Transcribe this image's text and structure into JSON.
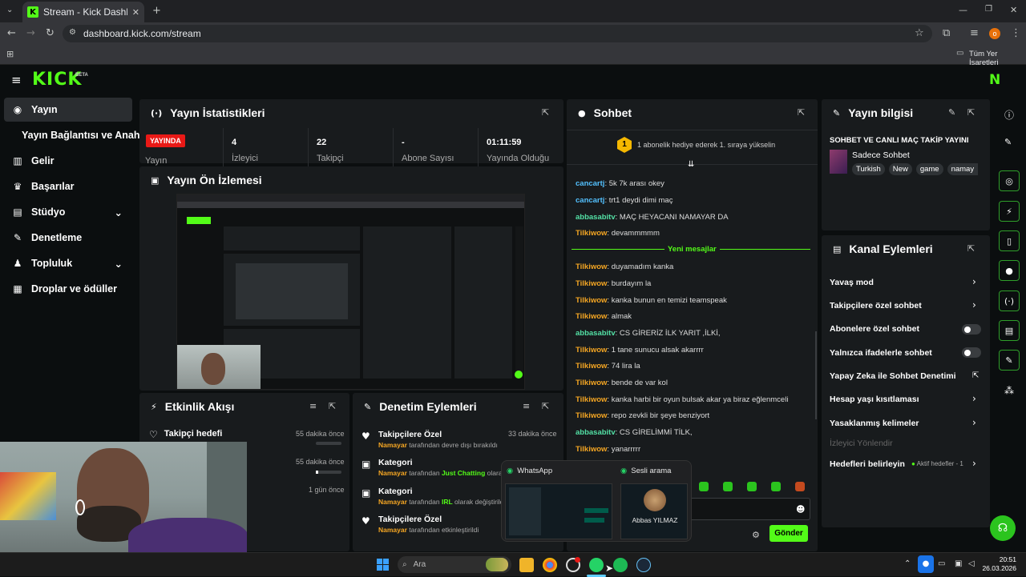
{
  "browser": {
    "tab_title": "Stream - Kick Dashboard",
    "url": "dashboard.kick.com/stream",
    "bookmarks_label": "Tüm Yer İşaretleri",
    "profile_initial": "o"
  },
  "header": {
    "logo": "KICK",
    "beta": "BETA",
    "avatar_initial": "N"
  },
  "sidebar": {
    "items": [
      {
        "label": "Yayın",
        "icon": "broadcast-icon"
      },
      {
        "label": "Yayın Bağlantısı ve Anahtarı",
        "icon": ""
      },
      {
        "label": "Gelir",
        "icon": "chart-icon"
      },
      {
        "label": "Başarılar",
        "icon": "trophy-icon"
      },
      {
        "label": "Stüdyo",
        "icon": "studio-icon"
      },
      {
        "label": "Denetleme",
        "icon": "wrench-icon"
      },
      {
        "label": "Topluluk",
        "icon": "people-icon"
      },
      {
        "label": "Droplar ve ödüller",
        "icon": "gift-icon"
      }
    ]
  },
  "stats": {
    "title": "Yayın İstatistikleri",
    "live_badge": "YAYINDA",
    "live_label": "Yayın",
    "cells": [
      {
        "value": "4",
        "label": "İzleyici"
      },
      {
        "value": "22",
        "label": "Takipçi"
      },
      {
        "value": "-",
        "label": "Abone Sayısı"
      },
      {
        "value": "01:11:59",
        "label": "Yayında Olduğu"
      }
    ]
  },
  "preview": {
    "title": "Yayın Ön İzlemesi"
  },
  "activity": {
    "title": "Etkinlik Akışı",
    "items": [
      {
        "title": "Takipçi hedefi",
        "time": "55 dakika önce"
      },
      {
        "title": "",
        "time": "55 dakika önce"
      },
      {
        "title": "",
        "time": "1 gün önce"
      }
    ]
  },
  "moderation": {
    "title": "Denetim Eylemleri",
    "items": [
      {
        "title": "Takipçilere Özel",
        "user": "Namayar",
        "desc": "tarafından devre dışı bırakıldı",
        "highlight": "",
        "desc2": "",
        "time": "33 dakika önce"
      },
      {
        "title": "Kategori",
        "user": "Namayar",
        "desc": "tarafından",
        "highlight": "Just Chatting",
        "desc2": "olara",
        "time": ""
      },
      {
        "title": "Kategori",
        "user": "Namayar",
        "desc": "tarafından",
        "highlight": "IRL",
        "desc2": "olarak değiştirild",
        "time": ""
      },
      {
        "title": "Takipçilere Özel",
        "user": "Namayar",
        "desc": "tarafından etkinleştirildi",
        "highlight": "",
        "desc2": "",
        "time": ""
      }
    ]
  },
  "chat": {
    "title": "Sohbet",
    "pinned_number": "1",
    "pinned_text": "1 abonelik hediye ederek 1. sıraya yükselin",
    "new_messages": "Yeni mesajlar",
    "messages_before": [
      {
        "user": "cancartj",
        "text": "5k 7k arası okey",
        "color": "#53c1ff"
      },
      {
        "user": "cancartj",
        "text": "trt1 deydi dimi maç",
        "color": "#53c1ff"
      },
      {
        "user": "abbasabitv",
        "text": "MAÇ HEYACANI NAMAYAR DA",
        "color": "#53e0a5"
      },
      {
        "user": "Tilkiwow",
        "text": "devammmmm",
        "color": "#f5a623"
      }
    ],
    "messages_after": [
      {
        "user": "Tilkiwow",
        "text": "duyamadım kanka",
        "color": "#f5a623"
      },
      {
        "user": "Tilkiwow",
        "text": "burdayım la",
        "color": "#f5a623"
      },
      {
        "user": "Tilkiwow",
        "text": "kanka bunun en temizi teamspeak",
        "color": "#f5a623"
      },
      {
        "user": "Tilkiwow",
        "text": "almak",
        "color": "#f5a623"
      },
      {
        "user": "abbasabitv",
        "text": "CS GİRERİZ İLK YARIT ,İLKİ,",
        "color": "#53e0a5"
      },
      {
        "user": "Tilkiwow",
        "text": "1 tane sunucu alsak akarrrr",
        "color": "#f5a623"
      },
      {
        "user": "Tilkiwow",
        "text": "74 lira la",
        "color": "#f5a623"
      },
      {
        "user": "Tilkiwow",
        "text": "bende de var kol",
        "color": "#f5a623"
      },
      {
        "user": "Tilkiwow",
        "text": "kanka harbi bir oyun bulsak akar ya biraz eğlenmceli",
        "color": "#f5a623"
      },
      {
        "user": "Tilkiwow",
        "text": "repo zevkli bir şeye benziyort",
        "color": "#f5a623"
      },
      {
        "user": "abbasabitv",
        "text": "CS GİRELİMMİ TİLK,",
        "color": "#53e0a5"
      },
      {
        "user": "Tilkiwow",
        "text": "yanarrrrr",
        "color": "#f5a623"
      }
    ],
    "send_label": "Gönder"
  },
  "stream_info": {
    "title": "Yayın bilgisi",
    "stream_title": "SOHBET VE CANLI MAÇ TAKİP YAYINI",
    "category": "Sadece Sohbet",
    "tags": [
      "Turkish",
      "New",
      "game",
      "namay"
    ]
  },
  "channel_actions": {
    "title": "Kanal Eylemleri",
    "items": [
      {
        "label": "Yavaş mod",
        "control": "chevron"
      },
      {
        "label": "Takipçilere özel sohbet",
        "control": "chevron"
      },
      {
        "label": "Abonelere özel sohbet",
        "control": "toggle"
      },
      {
        "label": "Yalnızca ifadelerle sohbet",
        "control": "toggle"
      },
      {
        "label": "Yapay Zeka ile Sohbet Denetimi",
        "control": "external"
      },
      {
        "label": "Hesap yaşı kısıtlaması",
        "control": "chevron"
      },
      {
        "label": "Yasaklanmış kelimeler",
        "control": "chevron"
      },
      {
        "label": "İzleyici Yönlendir",
        "control": "disabled"
      },
      {
        "label": "Hedefleri belirleyin",
        "control": "chevron",
        "badge": "Aktif hedefler - 1"
      }
    ]
  },
  "whatsapp_popup": {
    "app_label": "WhatsApp",
    "call_label": "Sesli arama",
    "caller_name": "Abbas YILMAZ"
  },
  "taskbar": {
    "search_placeholder": "Ara",
    "time": "20:51",
    "date": "26.03.2026"
  },
  "colors": {
    "accent": "#53fc18",
    "live": "#e91916",
    "panel": "#181b1d",
    "background": "#0b0e0f"
  }
}
